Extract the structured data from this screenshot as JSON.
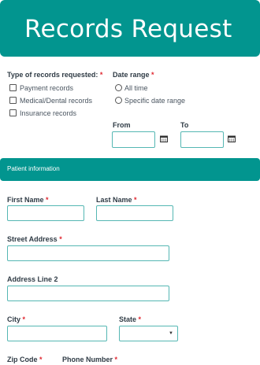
{
  "header": {
    "title": "Records Request"
  },
  "records": {
    "label": "Type of records requested:",
    "options": [
      "Payment records",
      "Medical/Dental records",
      "Insurance records"
    ]
  },
  "date_range": {
    "label": "Date range",
    "options": [
      "All time",
      "Specific date range"
    ],
    "from_label": "From",
    "to_label": "To"
  },
  "patient_section": {
    "title": "Patient information"
  },
  "fields": {
    "first_name": "First Name",
    "last_name": "Last Name",
    "street_address": "Street Address",
    "address_line_2": "Address Line 2",
    "city": "City",
    "state": "State",
    "zip": "Zip Code",
    "phone": "Phone Number"
  },
  "required_mark": "*",
  "colors": {
    "accent": "#02958f",
    "required": "#e0262f",
    "field_border": "#55b7b3"
  },
  "icons": {
    "date_picker": "calendar-icon",
    "select": "chevron-down-icon"
  }
}
